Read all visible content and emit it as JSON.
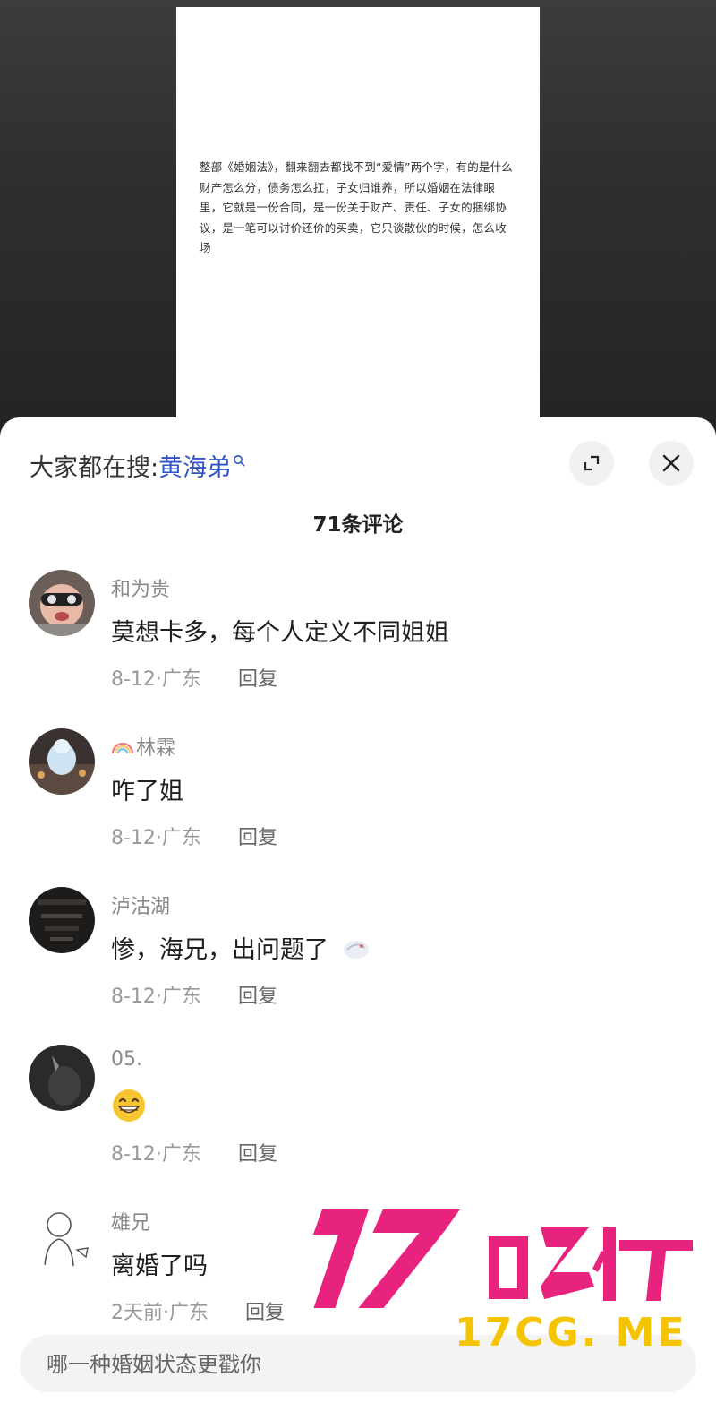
{
  "document": {
    "text": "整部《婚姻法》，翻来翻去都找不到“爱情”两个字，有的是什么财产怎么分，债务怎么扛，子女归谁养，所以婚姻在法律眼里，它就是一份合同，是一份关于财产、责任、子女的捆绑协议，是一笔可以讨价还价的买卖，它只谈散伙的时候，怎么收场"
  },
  "search_hint": {
    "prefix": "大家都在搜:",
    "term": "黄海弟"
  },
  "header": {
    "comment_count": "71条评论"
  },
  "comments": [
    {
      "user": "和为贵",
      "text": "莫想卡多，每个人定义不同姐姐",
      "meta": "8-12·广东",
      "reply": "回复"
    },
    {
      "user": "林霖",
      "text": "咋了姐",
      "meta": "8-12·广东",
      "reply": "回复"
    },
    {
      "user": "泸沽湖",
      "text": "惨，海兄，出问题了",
      "meta": "8-12·广东",
      "reply": "回复"
    },
    {
      "user": "05.",
      "text": "😁",
      "meta": "8-12·广东",
      "reply": "回复"
    },
    {
      "user": "雄兄",
      "text": "离婚了吗",
      "meta": "2天前·广东",
      "reply": "回复"
    }
  ],
  "input": {
    "placeholder": "哪一种婚姻状态更戳你"
  },
  "watermark": {
    "logo_text": "17吃瓜",
    "url": "17CG. ME"
  },
  "colors": {
    "link": "#2f54c7",
    "watermark": "#e8237e",
    "watermark_url": "#f5c400"
  }
}
